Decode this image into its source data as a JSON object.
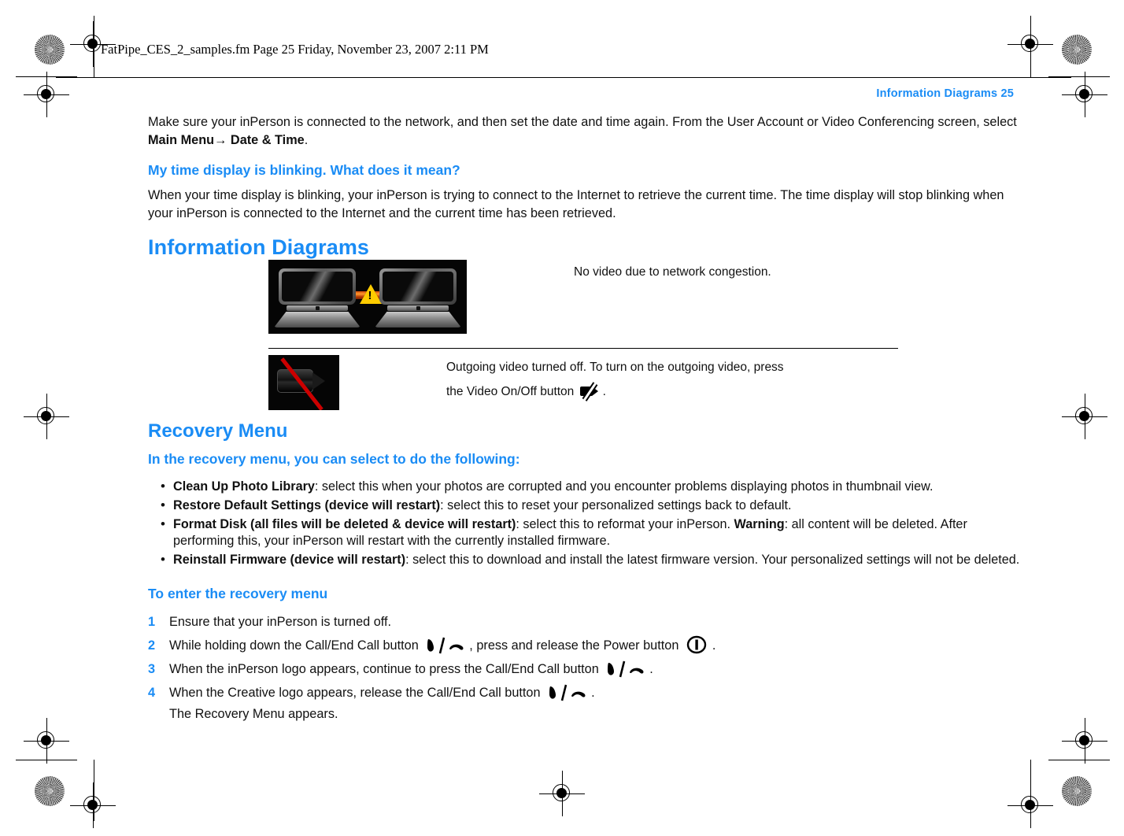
{
  "print_header": {
    "filename_line": "FatPipe_CES_2_samples.fm  Page 25  Friday, November 23, 2007  2:11 PM"
  },
  "running_head": "Information Diagrams  25",
  "intro": {
    "para1_a": "Make sure your inPerson is connected to the network, and then set the date and time again. From the User Account or Video Conferencing screen, select ",
    "para1_bold1": "Main Menu",
    "para1_arrow": "→",
    "para1_bold2": " Date & Time",
    "para1_end": "."
  },
  "faq": {
    "heading": "My time display is blinking. What does it mean?",
    "body": "When your time display is blinking, your inPerson is trying to connect to the Internet to retrieve the current time. The time display will stop blinking when your inPerson is connected to the Internet and the current time has been retrieved."
  },
  "information_diagrams": {
    "heading": "Information Diagrams",
    "rows": [
      {
        "image_name": "two-laptops-network-warning-diagram",
        "caption": "No video due to network congestion."
      },
      {
        "image_name": "video-camera-off-diagram",
        "caption_line1": "Outgoing video turned off. To turn on the outgoing video, press",
        "caption_line2_a": "the Video On/Off button ",
        "caption_line2_b": "."
      }
    ]
  },
  "recovery_menu": {
    "heading": "Recovery Menu",
    "subheading": "In the recovery menu, you can select to do the following:",
    "bullets": [
      {
        "bold": "Clean Up Photo Library",
        "rest": ": select this when your photos are corrupted and you encounter problems displaying photos in thumbnail view."
      },
      {
        "bold": "Restore Default Settings (device will restart)",
        "rest": ": select this to reset your personalized settings back to default."
      },
      {
        "bold": "Format Disk (all files will be deleted & device will restart)",
        "rest_a": ": select this to reformat your inPerson. ",
        "bold2": "Warning",
        "rest_b": ": all content will be deleted. After performing this, your inPerson will restart with the currently installed firmware."
      },
      {
        "bold": "Reinstall Firmware (device will restart)",
        "rest": ": select this to download and install the latest firmware version. Your personalized settings will not be deleted."
      }
    ],
    "procedure_heading": "To enter the recovery menu",
    "steps": [
      {
        "num": "1",
        "text_a": "Ensure that your inPerson is turned off.",
        "text_b": ""
      },
      {
        "num": "2",
        "text_a": "While holding down the Call/End Call button ",
        "text_b": ", press and release the Power button ",
        "text_c": "."
      },
      {
        "num": "3",
        "text_a": "When the inPerson logo appears, continue to press the Call/End Call button ",
        "text_b": "."
      },
      {
        "num": "4",
        "text_a": "When the Creative logo appears, release the Call/End Call button ",
        "text_b": "."
      }
    ],
    "steps_footer": "The Recovery Menu appears."
  },
  "colors": {
    "accent_blue": "#1a8cf5",
    "body_text": "#111111",
    "warning_yellow": "#ffcc00",
    "slash_red": "#cc0000",
    "link_orange": "#d24a08"
  }
}
